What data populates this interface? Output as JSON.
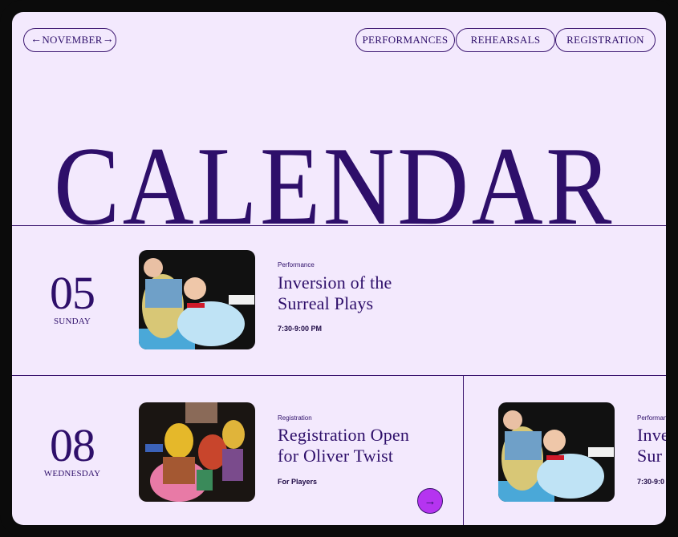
{
  "nav": {
    "month_label": "NOVEMBER",
    "prev_icon": "arrow-left-icon",
    "next_icon": "arrow-right-icon",
    "tabs": [
      {
        "label": "PERFORMANCES"
      },
      {
        "label": "REHEARSALS"
      },
      {
        "label": "REGISTRATION"
      }
    ]
  },
  "page": {
    "title": "CALENDAR"
  },
  "events": [
    {
      "day": "05",
      "weekday": "SUNDAY",
      "category": "Performance",
      "title_line1": "Inversion of the",
      "title_line2": "Surreal Plays",
      "detail": "7:30-9:00 PM"
    },
    {
      "day": "08",
      "weekday": "WEDNESDAY",
      "category": "Registration",
      "title_line1": "Registration Open",
      "title_line2": "for Oliver Twist",
      "detail": "For Players"
    },
    {
      "category": "Performance",
      "title_line1": "Inve",
      "title_line2": "Sur",
      "detail": "7:30-9:0"
    }
  ],
  "colors": {
    "background": "#f3e9fd",
    "primary": "#2e0f6a",
    "accent": "#b534f0"
  }
}
